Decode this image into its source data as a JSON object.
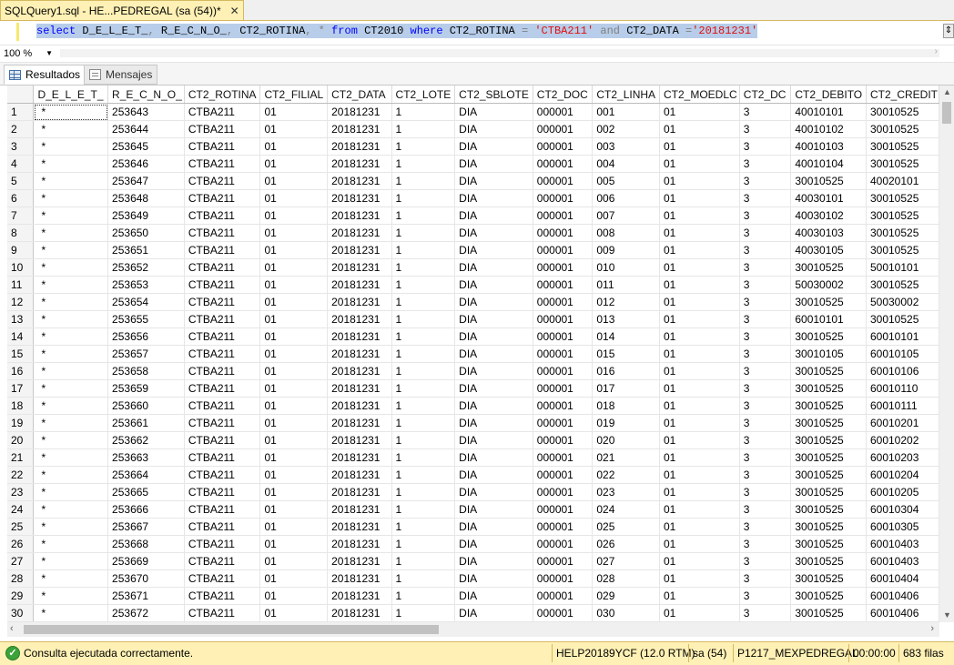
{
  "tab": {
    "title": "SQLQuery1.sql - HE...PEDREGAL (sa (54))*",
    "close": "✕"
  },
  "editor": {
    "tokens": [
      {
        "t": "select",
        "c": "kw"
      },
      {
        "t": " D_E_L_E_T_",
        "c": "tx"
      },
      {
        "t": ",",
        "c": "gr"
      },
      {
        "t": " R_E_C_N_O_",
        "c": "tx"
      },
      {
        "t": ",",
        "c": "gr"
      },
      {
        "t": " CT2_ROTINA",
        "c": "tx"
      },
      {
        "t": ", * ",
        "c": "gr"
      },
      {
        "t": "from",
        "c": "kw"
      },
      {
        "t": " CT2010 ",
        "c": "tx"
      },
      {
        "t": "where",
        "c": "kw"
      },
      {
        "t": " CT2_ROTINA ",
        "c": "tx"
      },
      {
        "t": "= ",
        "c": "gr"
      },
      {
        "t": "'CTBA211'",
        "c": "str"
      },
      {
        "t": " and ",
        "c": "gr"
      },
      {
        "t": "CT2_DATA ",
        "c": "tx"
      },
      {
        "t": "=",
        "c": "gr"
      },
      {
        "t": "'20181231'",
        "c": "str"
      }
    ],
    "split_icon": "⇕"
  },
  "zoom": {
    "value": "100 %"
  },
  "results_tabs": {
    "results": "Resultados",
    "messages": "Mensajes"
  },
  "grid": {
    "columns": [
      "D_E_L_E_T_",
      "R_E_C_N_O_",
      "CT2_ROTINA",
      "CT2_FILIAL",
      "CT2_DATA",
      "CT2_LOTE",
      "CT2_SBLOTE",
      "CT2_DOC",
      "CT2_LINHA",
      "CT2_MOEDLC",
      "CT2_DC",
      "CT2_DEBITO",
      "CT2_CREDIT"
    ],
    "rows": [
      [
        "1",
        "*",
        "253643",
        "CTBA211",
        "01",
        "20181231",
        "1",
        "DIA",
        "000001",
        "001",
        "01",
        "3",
        "40010101",
        "30010525"
      ],
      [
        "2",
        "*",
        "253644",
        "CTBA211",
        "01",
        "20181231",
        "1",
        "DIA",
        "000001",
        "002",
        "01",
        "3",
        "40010102",
        "30010525"
      ],
      [
        "3",
        "*",
        "253645",
        "CTBA211",
        "01",
        "20181231",
        "1",
        "DIA",
        "000001",
        "003",
        "01",
        "3",
        "40010103",
        "30010525"
      ],
      [
        "4",
        "*",
        "253646",
        "CTBA211",
        "01",
        "20181231",
        "1",
        "DIA",
        "000001",
        "004",
        "01",
        "3",
        "40010104",
        "30010525"
      ],
      [
        "5",
        "*",
        "253647",
        "CTBA211",
        "01",
        "20181231",
        "1",
        "DIA",
        "000001",
        "005",
        "01",
        "3",
        "30010525",
        "40020101"
      ],
      [
        "6",
        "*",
        "253648",
        "CTBA211",
        "01",
        "20181231",
        "1",
        "DIA",
        "000001",
        "006",
        "01",
        "3",
        "40030101",
        "30010525"
      ],
      [
        "7",
        "*",
        "253649",
        "CTBA211",
        "01",
        "20181231",
        "1",
        "DIA",
        "000001",
        "007",
        "01",
        "3",
        "40030102",
        "30010525"
      ],
      [
        "8",
        "*",
        "253650",
        "CTBA211",
        "01",
        "20181231",
        "1",
        "DIA",
        "000001",
        "008",
        "01",
        "3",
        "40030103",
        "30010525"
      ],
      [
        "9",
        "*",
        "253651",
        "CTBA211",
        "01",
        "20181231",
        "1",
        "DIA",
        "000001",
        "009",
        "01",
        "3",
        "40030105",
        "30010525"
      ],
      [
        "10",
        "*",
        "253652",
        "CTBA211",
        "01",
        "20181231",
        "1",
        "DIA",
        "000001",
        "010",
        "01",
        "3",
        "30010525",
        "50010101"
      ],
      [
        "11",
        "*",
        "253653",
        "CTBA211",
        "01",
        "20181231",
        "1",
        "DIA",
        "000001",
        "011",
        "01",
        "3",
        "50030002",
        "30010525"
      ],
      [
        "12",
        "*",
        "253654",
        "CTBA211",
        "01",
        "20181231",
        "1",
        "DIA",
        "000001",
        "012",
        "01",
        "3",
        "30010525",
        "50030002"
      ],
      [
        "13",
        "*",
        "253655",
        "CTBA211",
        "01",
        "20181231",
        "1",
        "DIA",
        "000001",
        "013",
        "01",
        "3",
        "60010101",
        "30010525"
      ],
      [
        "14",
        "*",
        "253656",
        "CTBA211",
        "01",
        "20181231",
        "1",
        "DIA",
        "000001",
        "014",
        "01",
        "3",
        "30010525",
        "60010101"
      ],
      [
        "15",
        "*",
        "253657",
        "CTBA211",
        "01",
        "20181231",
        "1",
        "DIA",
        "000001",
        "015",
        "01",
        "3",
        "30010105",
        "60010105"
      ],
      [
        "16",
        "*",
        "253658",
        "CTBA211",
        "01",
        "20181231",
        "1",
        "DIA",
        "000001",
        "016",
        "01",
        "3",
        "30010525",
        "60010106"
      ],
      [
        "17",
        "*",
        "253659",
        "CTBA211",
        "01",
        "20181231",
        "1",
        "DIA",
        "000001",
        "017",
        "01",
        "3",
        "30010525",
        "60010110"
      ],
      [
        "18",
        "*",
        "253660",
        "CTBA211",
        "01",
        "20181231",
        "1",
        "DIA",
        "000001",
        "018",
        "01",
        "3",
        "30010525",
        "60010111"
      ],
      [
        "19",
        "*",
        "253661",
        "CTBA211",
        "01",
        "20181231",
        "1",
        "DIA",
        "000001",
        "019",
        "01",
        "3",
        "30010525",
        "60010201"
      ],
      [
        "20",
        "*",
        "253662",
        "CTBA211",
        "01",
        "20181231",
        "1",
        "DIA",
        "000001",
        "020",
        "01",
        "3",
        "30010525",
        "60010202"
      ],
      [
        "21",
        "*",
        "253663",
        "CTBA211",
        "01",
        "20181231",
        "1",
        "DIA",
        "000001",
        "021",
        "01",
        "3",
        "30010525",
        "60010203"
      ],
      [
        "22",
        "*",
        "253664",
        "CTBA211",
        "01",
        "20181231",
        "1",
        "DIA",
        "000001",
        "022",
        "01",
        "3",
        "30010525",
        "60010204"
      ],
      [
        "23",
        "*",
        "253665",
        "CTBA211",
        "01",
        "20181231",
        "1",
        "DIA",
        "000001",
        "023",
        "01",
        "3",
        "30010525",
        "60010205"
      ],
      [
        "24",
        "*",
        "253666",
        "CTBA211",
        "01",
        "20181231",
        "1",
        "DIA",
        "000001",
        "024",
        "01",
        "3",
        "30010525",
        "60010304"
      ],
      [
        "25",
        "*",
        "253667",
        "CTBA211",
        "01",
        "20181231",
        "1",
        "DIA",
        "000001",
        "025",
        "01",
        "3",
        "30010525",
        "60010305"
      ],
      [
        "26",
        "*",
        "253668",
        "CTBA211",
        "01",
        "20181231",
        "1",
        "DIA",
        "000001",
        "026",
        "01",
        "3",
        "30010525",
        "60010403"
      ],
      [
        "27",
        "*",
        "253669",
        "CTBA211",
        "01",
        "20181231",
        "1",
        "DIA",
        "000001",
        "027",
        "01",
        "3",
        "30010525",
        "60010403"
      ],
      [
        "28",
        "*",
        "253670",
        "CTBA211",
        "01",
        "20181231",
        "1",
        "DIA",
        "000001",
        "028",
        "01",
        "3",
        "30010525",
        "60010404"
      ],
      [
        "29",
        "*",
        "253671",
        "CTBA211",
        "01",
        "20181231",
        "1",
        "DIA",
        "000001",
        "029",
        "01",
        "3",
        "30010525",
        "60010406"
      ],
      [
        "30",
        "*",
        "253672",
        "CTBA211",
        "01",
        "20181231",
        "1",
        "DIA",
        "000001",
        "030",
        "01",
        "3",
        "30010525",
        "60010406"
      ]
    ]
  },
  "status": {
    "message": "Consulta ejecutada correctamente.",
    "server": "HELP20189YCF (12.0 RTM)",
    "user": "sa (54)",
    "database": "P1217_MEXPEDREGAL",
    "time": "00:00:00",
    "rows": "683 filas"
  },
  "colors": {
    "status_bg": "#fff1b5",
    "keyword": "#0000ff",
    "string": "#e01010",
    "selection": "#b7cde9"
  },
  "icons": {
    "results": "grid-icon",
    "messages": "messages-icon",
    "success": "check-circle-icon"
  }
}
